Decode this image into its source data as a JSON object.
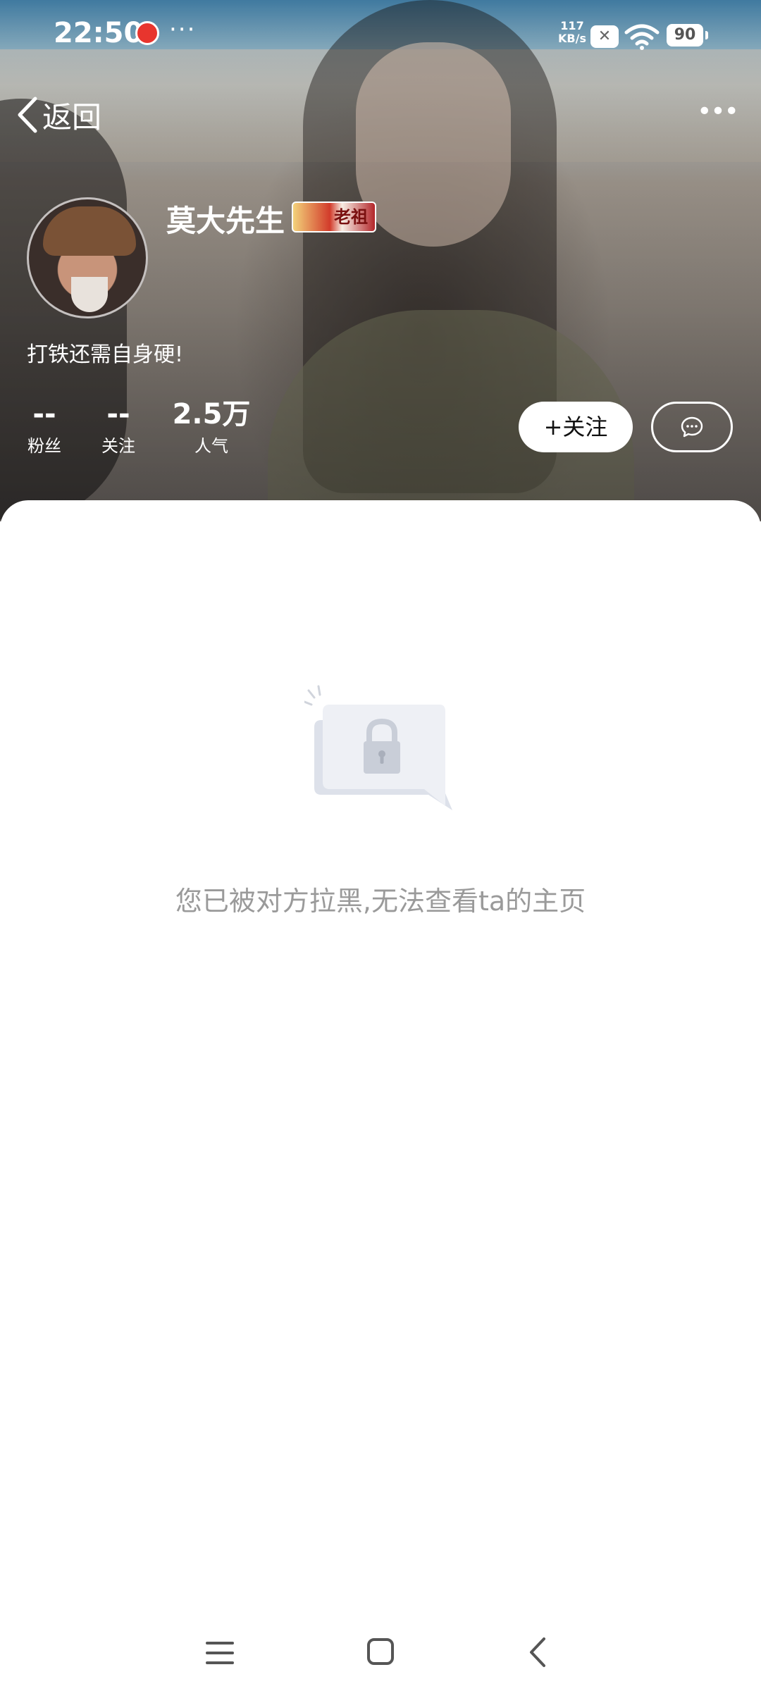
{
  "status_bar": {
    "time": "22:50",
    "dots": "···",
    "net_speed_value": "117",
    "net_speed_unit": "KB/s",
    "battery": "90"
  },
  "nav": {
    "back_label": "返回"
  },
  "profile": {
    "username": "莫大先生",
    "badge_text": "老祖",
    "bio": "打铁还需自身硬!",
    "stats": [
      {
        "value": "--",
        "label": "粉丝"
      },
      {
        "value": "--",
        "label": "关注"
      },
      {
        "value": "2.5万",
        "label": "人气"
      }
    ],
    "follow_label": "+关注"
  },
  "content": {
    "blocked_message": "您已被对方拉黑,无法查看ta的主页"
  },
  "icons": {
    "back": "chevron-left-icon",
    "more": "more-horizontal-icon",
    "chat": "chat-bubble-icon",
    "lock": "lock-icon",
    "nav_menu": "menu-icon",
    "nav_home": "home-square-icon",
    "nav_back": "back-arrow-icon"
  },
  "colors": {
    "message_gray": "#9a9a9a",
    "sheet_bg": "#ffffff"
  }
}
